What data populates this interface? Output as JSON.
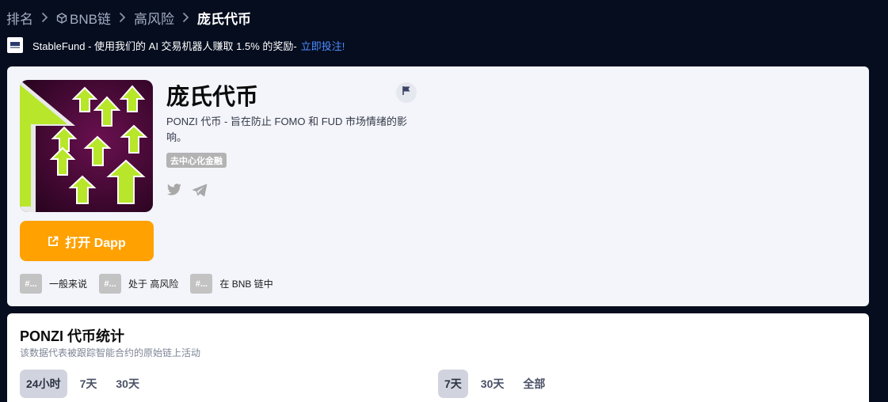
{
  "breadcrumb": {
    "items": [
      "排名",
      "BNB链",
      "高风险"
    ],
    "current": "庞氏代币"
  },
  "sponsor": {
    "text": "StableFund - 使用我们的 AI 交易机器人赚取 1.5% 的奖励-",
    "link": "立即投注!"
  },
  "token": {
    "name": "庞氏代币",
    "description": "PONZI 代币 - 旨在防止 FOMO 和 FUD 市场情绪的影响。",
    "category": "去中心化金融",
    "open_button": "打开 Dapp",
    "socials": [
      "twitter-icon",
      "telegram-icon"
    ]
  },
  "tags": [
    {
      "hash": "#...",
      "label": "一般来说"
    },
    {
      "hash": "#...",
      "label": "处于 高风险"
    },
    {
      "hash": "#...",
      "label": "在 BNB 链中"
    }
  ],
  "stats": {
    "title": "PONZI 代币统计",
    "subtitle": "该数据代表被跟踪智能合约的原始链上活动",
    "range_tabs_left": [
      "24小时",
      "7天",
      "30天"
    ],
    "range_tabs_right": [
      "7天",
      "30天",
      "全部"
    ],
    "active_left": "24小时",
    "active_right": "7天"
  },
  "colors": {
    "background": "#050d1f",
    "accent": "#ffa100",
    "link": "#4d8dff"
  }
}
